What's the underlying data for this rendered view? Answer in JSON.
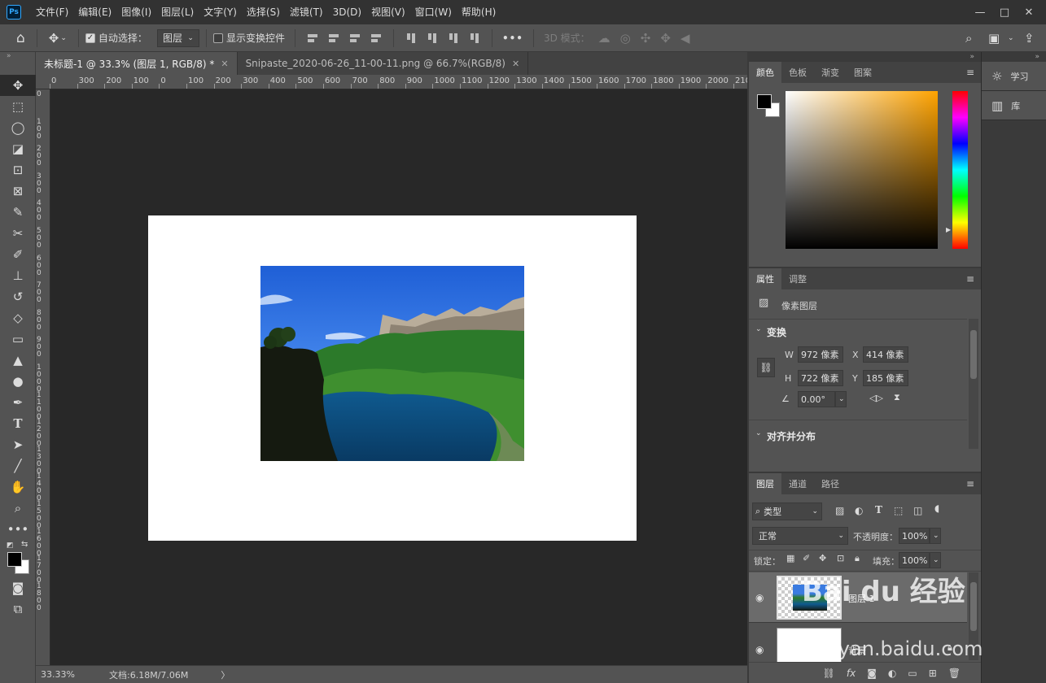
{
  "menubar": {
    "logo": "Ps",
    "items": [
      "文件(F)",
      "编辑(E)",
      "图像(I)",
      "图层(L)",
      "文字(Y)",
      "选择(S)",
      "滤镜(T)",
      "3D(D)",
      "视图(V)",
      "窗口(W)",
      "帮助(H)"
    ],
    "window_controls": [
      "—",
      "□",
      "✕"
    ]
  },
  "options": {
    "auto_select_label": "自动选择：",
    "auto_select_checked": true,
    "target_dropdown": "图层",
    "transform_controls_label": "显示变换控件",
    "transform_controls_checked": false,
    "more": "•••",
    "mode3d_label": "3D 模式："
  },
  "tabs": [
    {
      "label": "未标题-1 @ 33.3% (图层 1, RGB/8) *",
      "active": true
    },
    {
      "label": "Snipaste_2020-06-26_11-00-11.png @ 66.7%(RGB/8)",
      "active": false
    }
  ],
  "ruler": {
    "h_labels": [
      "0",
      "300",
      "200",
      "100",
      "0",
      "100",
      "200",
      "300",
      "400",
      "500",
      "600",
      "700",
      "800",
      "900",
      "1000",
      "1100",
      "1200",
      "1300",
      "1400",
      "1500",
      "1600",
      "1700",
      "1800",
      "1900",
      "2000",
      "210"
    ],
    "v_labels": [
      "0",
      "1 0 0",
      "2 0 0",
      "3 0 0",
      "4 0 0",
      "5 0 0",
      "6 0 0",
      "7 0 0",
      "8 0 0",
      "9 0 0",
      "1 0 0 0",
      "1 1 0 0",
      "1 2 0 0",
      "1 3 0 0",
      "1 4 0 0",
      "1 5 0 0",
      "1 6 0 0",
      "1 7 0 0",
      "1 8 0 0"
    ]
  },
  "status": {
    "zoom": "33.33%",
    "doc_info": "文档:6.18M/7.06M",
    "arrow": "〉"
  },
  "color_panel": {
    "tabs": [
      "颜色",
      "色板",
      "渐变",
      "图案"
    ],
    "foreground": "#000000",
    "background": "#ffffff",
    "hue_color": "#ffa300"
  },
  "properties_panel": {
    "tabs": [
      "属性",
      "调整"
    ],
    "layer_type": "像素图层",
    "transform_header": "变换",
    "w_label": "W",
    "w_value": "972 像素",
    "h_label": "H",
    "h_value": "722 像素",
    "x_label": "X",
    "x_value": "414 像素",
    "y_label": "Y",
    "y_value": "185 像素",
    "angle_value": "0.00°",
    "align_header": "对齐并分布"
  },
  "layers_panel": {
    "tabs": [
      "图层",
      "通道",
      "路径"
    ],
    "filter_dropdown": "类型",
    "blend_mode": "正常",
    "opacity_label": "不透明度：",
    "opacity_value": "100%",
    "lock_label": "锁定：",
    "fill_label": "填充：",
    "fill_value": "100%",
    "layers": [
      {
        "name": "图层 1",
        "visible": true,
        "selected": true
      },
      {
        "name": "背景",
        "visible": true,
        "selected": false
      }
    ]
  },
  "mini_panel": {
    "items": [
      {
        "label": "学习",
        "icon": "lightbulb-icon"
      },
      {
        "label": "库",
        "icon": "library-icon"
      }
    ]
  },
  "watermark": {
    "brand": "Bai du 经验",
    "url": "jingyan.baidu.com"
  }
}
